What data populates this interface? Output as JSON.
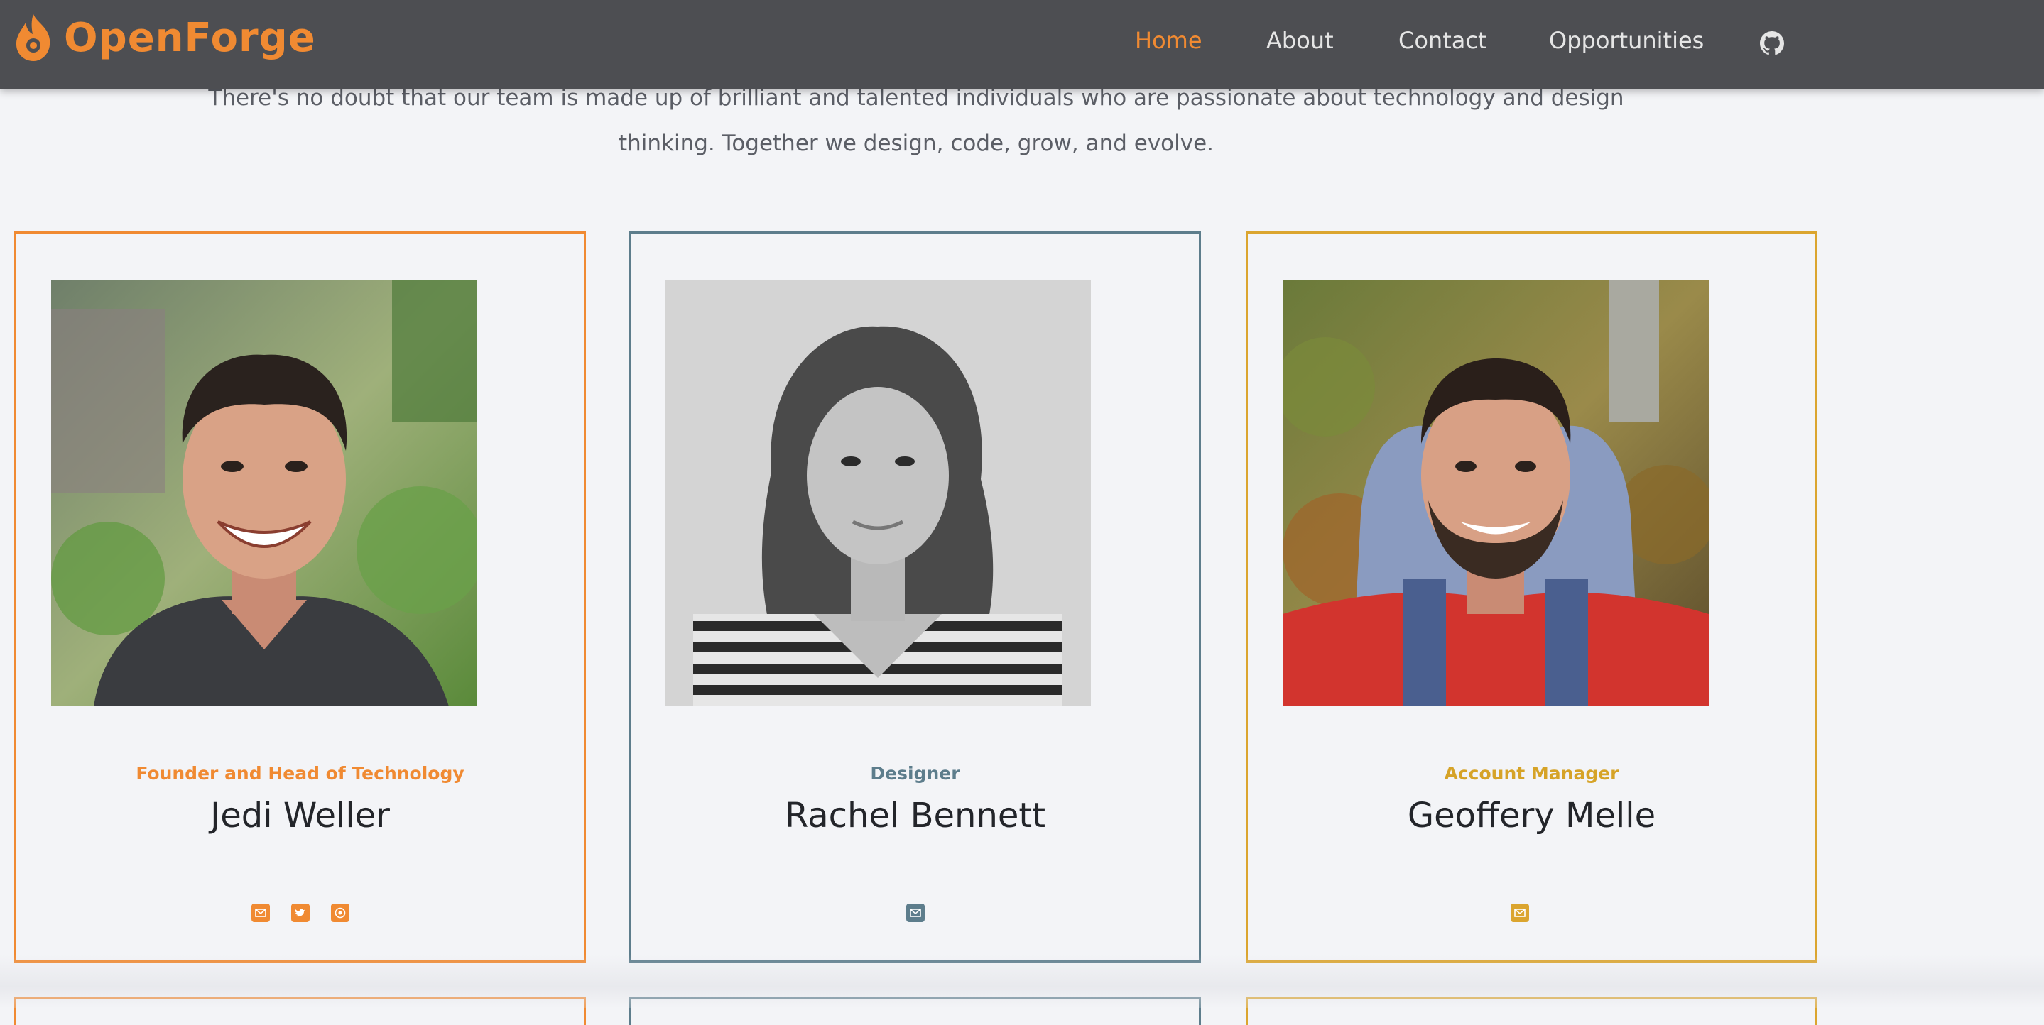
{
  "brand": {
    "name": "OpenForge",
    "accent": "#f08a32"
  },
  "nav": {
    "items": [
      {
        "label": "Home",
        "active": true
      },
      {
        "label": "About",
        "active": false
      },
      {
        "label": "Contact",
        "active": false
      },
      {
        "label": "Opportunities",
        "active": false
      }
    ],
    "github_icon": "github-icon"
  },
  "intro": {
    "line1": "There's no doubt that our team is made up of brilliant and talented individuals who are passionate about technology and design",
    "line2": "thinking. Together we design, code, grow, and evolve."
  },
  "team": [
    {
      "role": "Founder and Head of Technology",
      "name": "Jedi Weller",
      "color": "#f08a32",
      "socials": [
        "mail-icon",
        "twitter-icon",
        "github-icon"
      ]
    },
    {
      "role": "Designer",
      "name": "Rachel Bennett",
      "color": "#5d7d8c",
      "socials": [
        "mail-icon"
      ]
    },
    {
      "role": "Account Manager",
      "name": "Geoffery Melle",
      "color": "#dba52f",
      "socials": [
        "mail-icon"
      ]
    }
  ]
}
